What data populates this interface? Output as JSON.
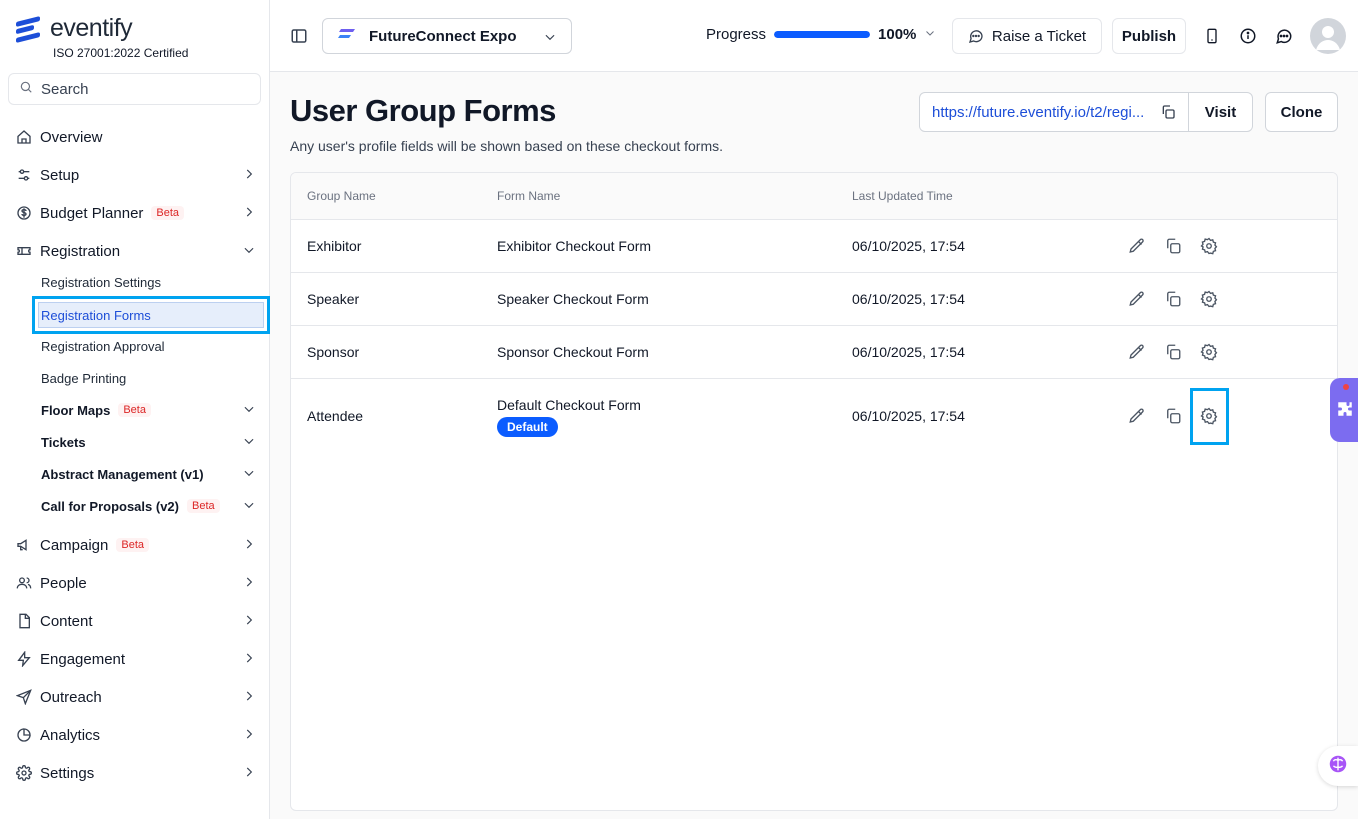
{
  "brand": {
    "name": "eventify",
    "certification": "ISO 27001:2022 Certified"
  },
  "sidebar": {
    "search_placeholder": "Search",
    "items": [
      {
        "label": "Overview",
        "icon": "home-icon"
      },
      {
        "label": "Setup",
        "icon": "sliders-icon"
      },
      {
        "label": "Budget Planner",
        "icon": "dollar-circle-icon",
        "badge": "Beta"
      },
      {
        "label": "Registration",
        "icon": "ticket-icon"
      },
      {
        "label": "Campaign",
        "icon": "megaphone-icon",
        "badge": "Beta"
      },
      {
        "label": "People",
        "icon": "users-icon"
      },
      {
        "label": "Content",
        "icon": "file-icon"
      },
      {
        "label": "Engagement",
        "icon": "zap-icon"
      },
      {
        "label": "Outreach",
        "icon": "send-icon"
      },
      {
        "label": "Analytics",
        "icon": "pie-chart-icon"
      },
      {
        "label": "Settings",
        "icon": "gear-icon"
      }
    ],
    "registration_sub": [
      {
        "label": "Registration Settings"
      },
      {
        "label": "Registration Forms",
        "active": true
      },
      {
        "label": "Registration Approval"
      },
      {
        "label": "Badge Printing"
      },
      {
        "label": "Floor Maps",
        "badge": "Beta"
      },
      {
        "label": "Tickets"
      },
      {
        "label": "Abstract Management (v1)"
      },
      {
        "label": "Call for Proposals (v2)",
        "badge": "Beta"
      }
    ]
  },
  "topbar": {
    "event_name": "FutureConnect Expo",
    "progress_label": "Progress",
    "progress_value": "100%",
    "progress_fraction": 1.0,
    "raise_ticket": "Raise a Ticket",
    "publish": "Publish"
  },
  "page": {
    "title": "User Group Forms",
    "subtitle": "Any user's profile fields will be shown based on these checkout forms.",
    "url": "https://future.eventify.io/t2/regi...",
    "visit": "Visit",
    "clone": "Clone"
  },
  "table": {
    "headers": {
      "group": "Group Name",
      "form": "Form Name",
      "updated": "Last Updated Time"
    },
    "rows": [
      {
        "group": "Exhibitor",
        "form": "Exhibitor Checkout Form",
        "updated": "06/10/2025, 17:54"
      },
      {
        "group": "Speaker",
        "form": "Speaker Checkout Form",
        "updated": "06/10/2025, 17:54"
      },
      {
        "group": "Sponsor",
        "form": "Sponsor Checkout Form",
        "updated": "06/10/2025, 17:54"
      },
      {
        "group": "Attendee",
        "form": "Default Checkout Form",
        "updated": "06/10/2025, 17:54",
        "badge": "Default"
      }
    ]
  },
  "colors": {
    "accent": "#0b5cff",
    "highlight": "#00a3f0",
    "beta": "#dc2626"
  }
}
